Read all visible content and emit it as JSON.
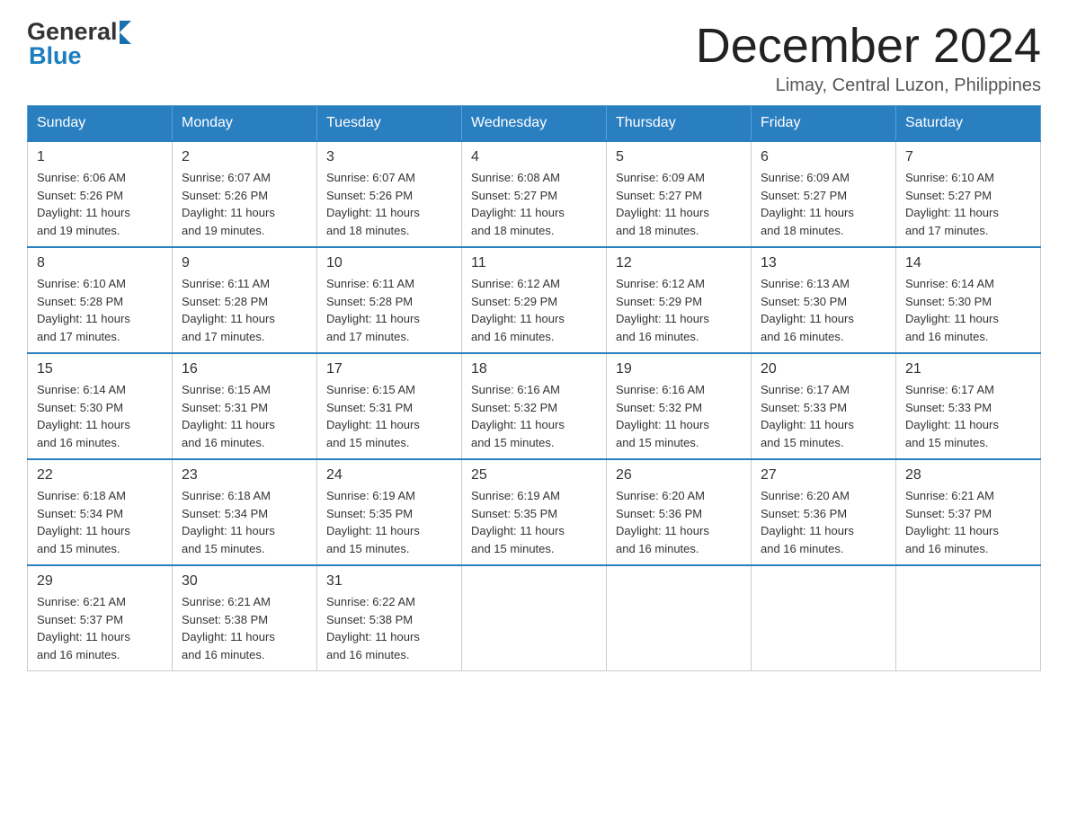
{
  "logo": {
    "general": "General",
    "blue": "Blue"
  },
  "title": "December 2024",
  "subtitle": "Limay, Central Luzon, Philippines",
  "weekdays": [
    "Sunday",
    "Monday",
    "Tuesday",
    "Wednesday",
    "Thursday",
    "Friday",
    "Saturday"
  ],
  "weeks": [
    [
      {
        "day": "1",
        "sunrise": "6:06 AM",
        "sunset": "5:26 PM",
        "daylight": "11 hours and 19 minutes."
      },
      {
        "day": "2",
        "sunrise": "6:07 AM",
        "sunset": "5:26 PM",
        "daylight": "11 hours and 19 minutes."
      },
      {
        "day": "3",
        "sunrise": "6:07 AM",
        "sunset": "5:26 PM",
        "daylight": "11 hours and 18 minutes."
      },
      {
        "day": "4",
        "sunrise": "6:08 AM",
        "sunset": "5:27 PM",
        "daylight": "11 hours and 18 minutes."
      },
      {
        "day": "5",
        "sunrise": "6:09 AM",
        "sunset": "5:27 PM",
        "daylight": "11 hours and 18 minutes."
      },
      {
        "day": "6",
        "sunrise": "6:09 AM",
        "sunset": "5:27 PM",
        "daylight": "11 hours and 18 minutes."
      },
      {
        "day": "7",
        "sunrise": "6:10 AM",
        "sunset": "5:27 PM",
        "daylight": "11 hours and 17 minutes."
      }
    ],
    [
      {
        "day": "8",
        "sunrise": "6:10 AM",
        "sunset": "5:28 PM",
        "daylight": "11 hours and 17 minutes."
      },
      {
        "day": "9",
        "sunrise": "6:11 AM",
        "sunset": "5:28 PM",
        "daylight": "11 hours and 17 minutes."
      },
      {
        "day": "10",
        "sunrise": "6:11 AM",
        "sunset": "5:28 PM",
        "daylight": "11 hours and 17 minutes."
      },
      {
        "day": "11",
        "sunrise": "6:12 AM",
        "sunset": "5:29 PM",
        "daylight": "11 hours and 16 minutes."
      },
      {
        "day": "12",
        "sunrise": "6:12 AM",
        "sunset": "5:29 PM",
        "daylight": "11 hours and 16 minutes."
      },
      {
        "day": "13",
        "sunrise": "6:13 AM",
        "sunset": "5:30 PM",
        "daylight": "11 hours and 16 minutes."
      },
      {
        "day": "14",
        "sunrise": "6:14 AM",
        "sunset": "5:30 PM",
        "daylight": "11 hours and 16 minutes."
      }
    ],
    [
      {
        "day": "15",
        "sunrise": "6:14 AM",
        "sunset": "5:30 PM",
        "daylight": "11 hours and 16 minutes."
      },
      {
        "day": "16",
        "sunrise": "6:15 AM",
        "sunset": "5:31 PM",
        "daylight": "11 hours and 16 minutes."
      },
      {
        "day": "17",
        "sunrise": "6:15 AM",
        "sunset": "5:31 PM",
        "daylight": "11 hours and 15 minutes."
      },
      {
        "day": "18",
        "sunrise": "6:16 AM",
        "sunset": "5:32 PM",
        "daylight": "11 hours and 15 minutes."
      },
      {
        "day": "19",
        "sunrise": "6:16 AM",
        "sunset": "5:32 PM",
        "daylight": "11 hours and 15 minutes."
      },
      {
        "day": "20",
        "sunrise": "6:17 AM",
        "sunset": "5:33 PM",
        "daylight": "11 hours and 15 minutes."
      },
      {
        "day": "21",
        "sunrise": "6:17 AM",
        "sunset": "5:33 PM",
        "daylight": "11 hours and 15 minutes."
      }
    ],
    [
      {
        "day": "22",
        "sunrise": "6:18 AM",
        "sunset": "5:34 PM",
        "daylight": "11 hours and 15 minutes."
      },
      {
        "day": "23",
        "sunrise": "6:18 AM",
        "sunset": "5:34 PM",
        "daylight": "11 hours and 15 minutes."
      },
      {
        "day": "24",
        "sunrise": "6:19 AM",
        "sunset": "5:35 PM",
        "daylight": "11 hours and 15 minutes."
      },
      {
        "day": "25",
        "sunrise": "6:19 AM",
        "sunset": "5:35 PM",
        "daylight": "11 hours and 15 minutes."
      },
      {
        "day": "26",
        "sunrise": "6:20 AM",
        "sunset": "5:36 PM",
        "daylight": "11 hours and 16 minutes."
      },
      {
        "day": "27",
        "sunrise": "6:20 AM",
        "sunset": "5:36 PM",
        "daylight": "11 hours and 16 minutes."
      },
      {
        "day": "28",
        "sunrise": "6:21 AM",
        "sunset": "5:37 PM",
        "daylight": "11 hours and 16 minutes."
      }
    ],
    [
      {
        "day": "29",
        "sunrise": "6:21 AM",
        "sunset": "5:37 PM",
        "daylight": "11 hours and 16 minutes."
      },
      {
        "day": "30",
        "sunrise": "6:21 AM",
        "sunset": "5:38 PM",
        "daylight": "11 hours and 16 minutes."
      },
      {
        "day": "31",
        "sunrise": "6:22 AM",
        "sunset": "5:38 PM",
        "daylight": "11 hours and 16 minutes."
      },
      null,
      null,
      null,
      null
    ]
  ],
  "labels": {
    "sunrise": "Sunrise: ",
    "sunset": "Sunset: ",
    "daylight": "Daylight: "
  }
}
